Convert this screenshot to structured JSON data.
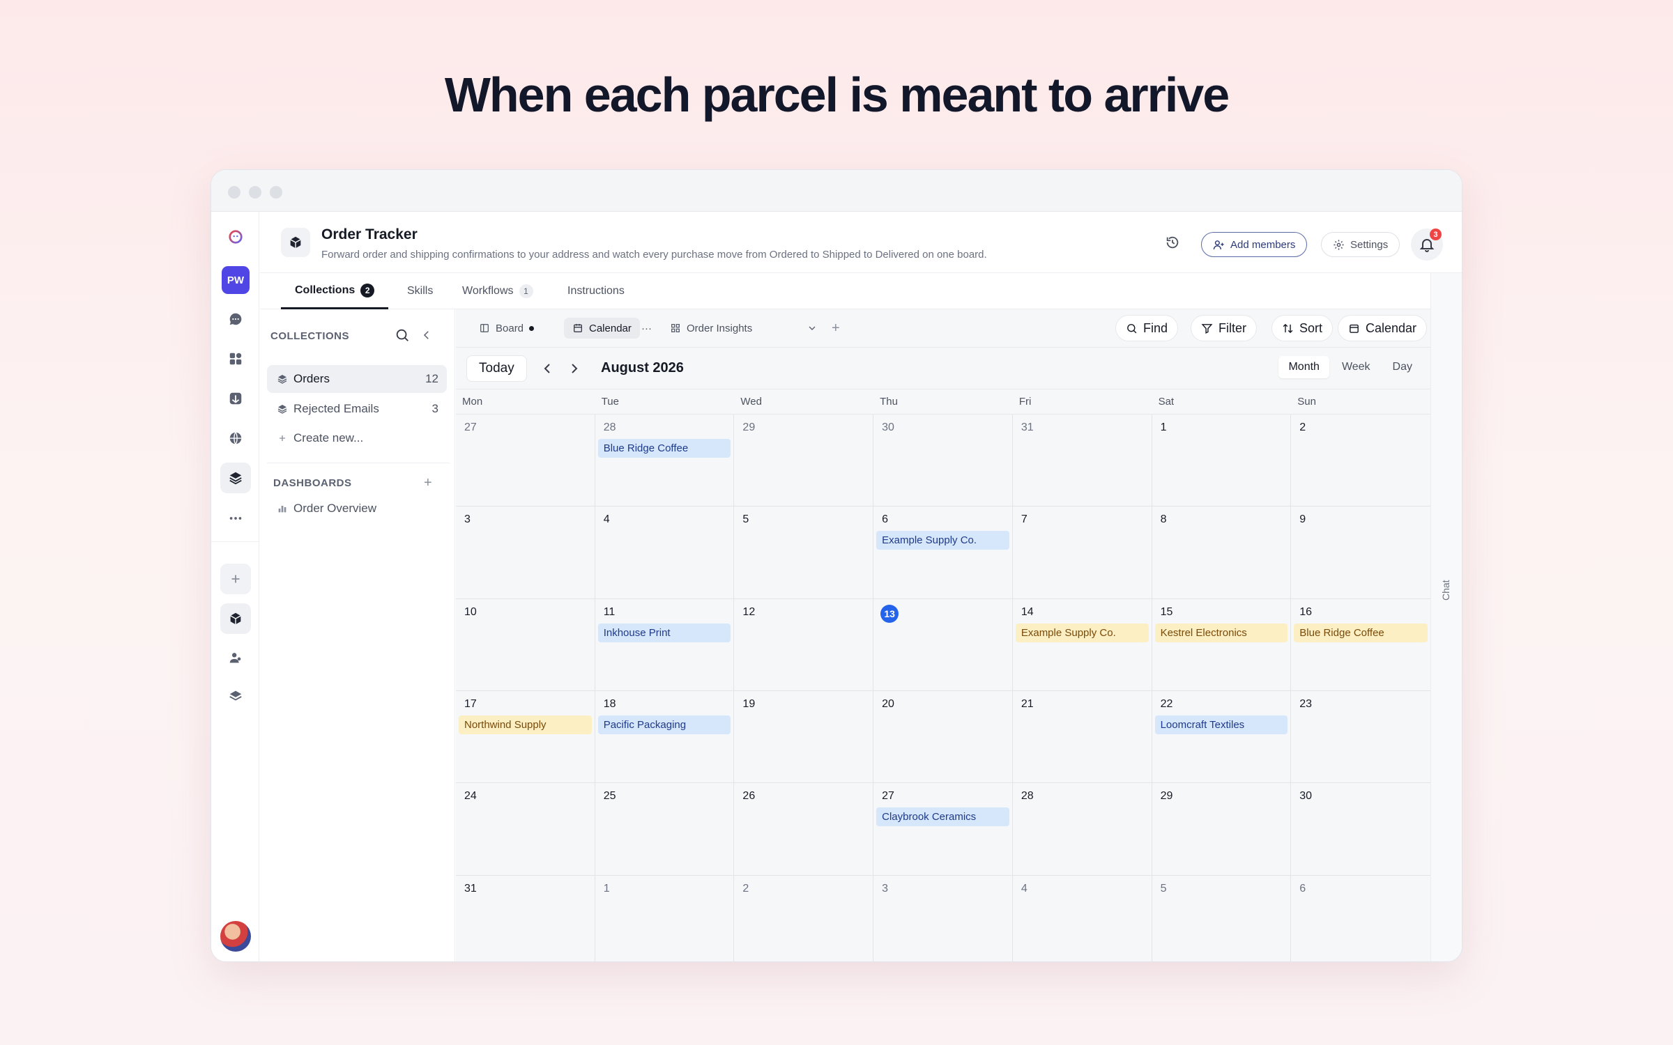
{
  "headline": "When each parcel is meant to arrive",
  "header": {
    "title": "Order Tracker",
    "description": "Forward order and shipping confirmations to your address and watch every purchase move from Ordered to Shipped to Delivered on one board.",
    "add_members": "Add members",
    "settings": "Settings",
    "notifications": "3"
  },
  "sidebar": {
    "workspace_initials": "PW",
    "icons": [
      "logo-icon",
      "chat-icon",
      "apps-icon",
      "inbox-icon",
      "globe-icon",
      "layers-icon",
      "more-icon",
      "plus-icon",
      "box-icon",
      "people-icon",
      "stack-icon"
    ]
  },
  "tabs": [
    {
      "label": "Collections",
      "count": "2"
    },
    {
      "label": "Skills",
      "count": ""
    },
    {
      "label": "Workflows",
      "count": "1"
    },
    {
      "label": "Instructions",
      "count": ""
    }
  ],
  "collections": {
    "heading": "COLLECTIONS",
    "items": [
      {
        "label": "Orders",
        "count": "12"
      },
      {
        "label": "Rejected Emails",
        "count": "3"
      }
    ],
    "create": "Create new...",
    "dashboards_heading": "DASHBOARDS",
    "dashboards": [
      {
        "label": "Order Overview"
      }
    ]
  },
  "views": {
    "board": "Board",
    "calendar": "Calendar",
    "more": "···",
    "insights": "Order Insights",
    "add": "+"
  },
  "tools": {
    "find": "Find",
    "filter": "Filter",
    "sort": "Sort",
    "calendar": "Calendar"
  },
  "calendar": {
    "today": "Today",
    "month": "August 2026",
    "modes": [
      "Month",
      "Week",
      "Day"
    ],
    "active_mode": "Month",
    "weekdays": [
      "Mon",
      "Tue",
      "Wed",
      "Thu",
      "Fri",
      "Sat",
      "Sun"
    ],
    "weeks": [
      [
        {
          "d": "27",
          "m": true
        },
        {
          "d": "28",
          "m": true,
          "ev": [
            {
              "t": "Blue Ridge Coffee",
              "c": "blue"
            }
          ]
        },
        {
          "d": "29",
          "m": true
        },
        {
          "d": "30",
          "m": true
        },
        {
          "d": "31",
          "m": true
        },
        {
          "d": "1"
        },
        {
          "d": "2"
        }
      ],
      [
        {
          "d": "3"
        },
        {
          "d": "4"
        },
        {
          "d": "5"
        },
        {
          "d": "6",
          "ev": [
            {
              "t": "Example Supply Co.",
              "c": "blue"
            }
          ]
        },
        {
          "d": "7"
        },
        {
          "d": "8"
        },
        {
          "d": "9"
        }
      ],
      [
        {
          "d": "10"
        },
        {
          "d": "11",
          "ev": [
            {
              "t": "Inkhouse Print",
              "c": "blue"
            }
          ]
        },
        {
          "d": "12"
        },
        {
          "d": "13",
          "today": true
        },
        {
          "d": "14",
          "ev": [
            {
              "t": "Example Supply Co.",
              "c": "yellow"
            }
          ]
        },
        {
          "d": "15",
          "ev": [
            {
              "t": "Kestrel Electronics",
              "c": "yellow"
            }
          ]
        },
        {
          "d": "16",
          "ev": [
            {
              "t": "Blue Ridge Coffee",
              "c": "yellow"
            }
          ]
        }
      ],
      [
        {
          "d": "17",
          "ev": [
            {
              "t": "Northwind Supply",
              "c": "yellow"
            }
          ]
        },
        {
          "d": "18",
          "ev": [
            {
              "t": "Pacific Packaging",
              "c": "blue"
            }
          ]
        },
        {
          "d": "19"
        },
        {
          "d": "20"
        },
        {
          "d": "21"
        },
        {
          "d": "22",
          "ev": [
            {
              "t": "Loomcraft Textiles",
              "c": "blue"
            }
          ]
        },
        {
          "d": "23"
        }
      ],
      [
        {
          "d": "24"
        },
        {
          "d": "25"
        },
        {
          "d": "26"
        },
        {
          "d": "27",
          "ev": [
            {
              "t": "Claybrook Ceramics",
              "c": "blue"
            }
          ]
        },
        {
          "d": "28"
        },
        {
          "d": "29"
        },
        {
          "d": "30"
        }
      ],
      [
        {
          "d": "31"
        },
        {
          "d": "1",
          "m": true
        },
        {
          "d": "2",
          "m": true
        },
        {
          "d": "3",
          "m": true
        },
        {
          "d": "4",
          "m": true
        },
        {
          "d": "5",
          "m": true
        },
        {
          "d": "6",
          "m": true
        }
      ]
    ]
  },
  "chat_label": "Chat"
}
